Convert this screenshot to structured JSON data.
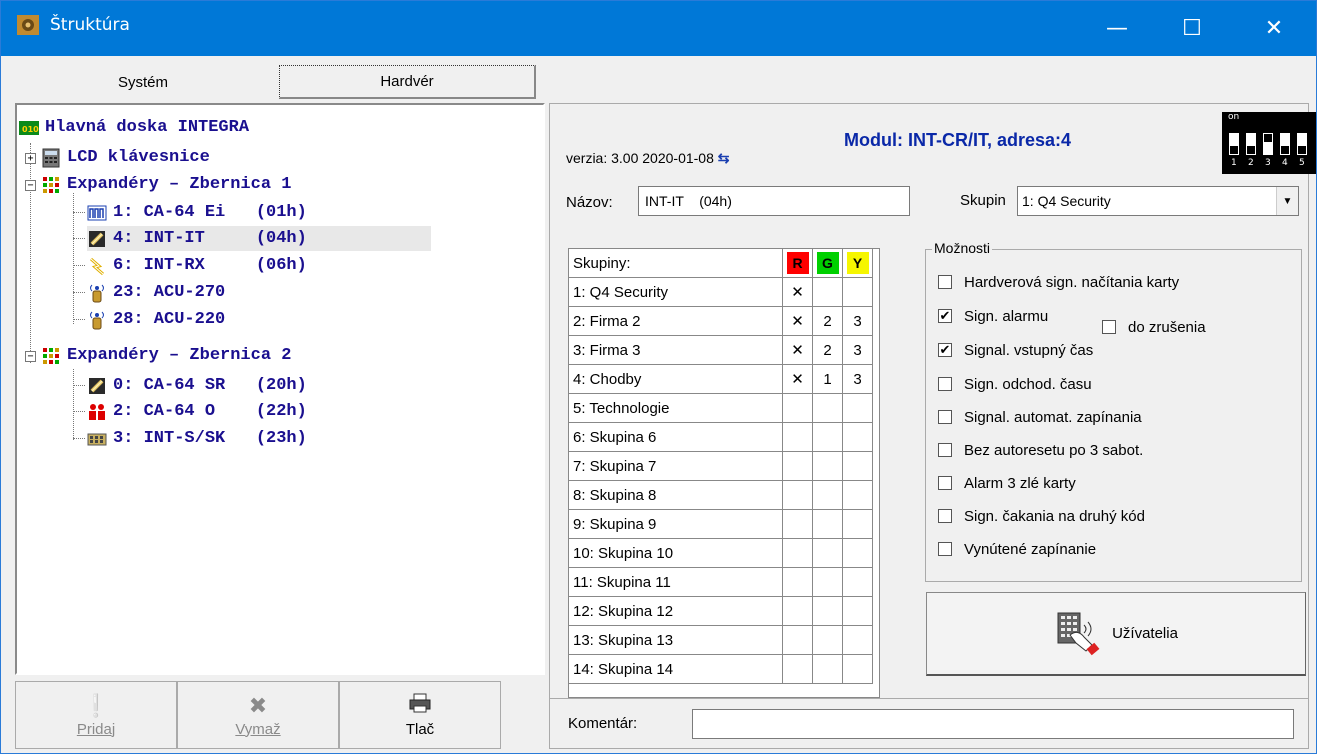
{
  "window": {
    "title": "Štruktúra",
    "controls": {
      "minimize": "—",
      "maximize": "☐",
      "close": "✕"
    }
  },
  "tabs": [
    {
      "label": "Systém",
      "active": false
    },
    {
      "label": "Hardvér",
      "active": true
    }
  ],
  "tree": {
    "root": "Hlavná doska INTEGRA",
    "lcd": "LCD klávesnice",
    "bus1": {
      "label": "Expandéry – Zbernica 1",
      "items": [
        {
          "label": "1: CA-64 Ei   (01h)",
          "icon": "zone-expander-icon"
        },
        {
          "label": "4: INT-IT     (04h)",
          "icon": "proximity-reader-icon",
          "selected": true
        },
        {
          "label": "6: INT-RX     (06h)",
          "icon": "radio-receiver-icon"
        },
        {
          "label": "23: ACU-270",
          "icon": "wireless-controller-icon"
        },
        {
          "label": "28: ACU-220",
          "icon": "wireless-controller-icon"
        }
      ]
    },
    "bus2": {
      "label": "Expandéry – Zbernica 2",
      "items": [
        {
          "label": "0: CA-64 SR   (20h)",
          "icon": "proximity-reader-icon"
        },
        {
          "label": "2: CA-64 O    (22h)",
          "icon": "output-expander-icon"
        },
        {
          "label": "3: INT-S/SK   (23h)",
          "icon": "keypad-icon"
        }
      ]
    }
  },
  "toolbar": {
    "add": {
      "label": "Pridaj",
      "enabled": false
    },
    "delete": {
      "label": "Vymaž",
      "enabled": false
    },
    "print": {
      "label": "Tlač",
      "enabled": true
    }
  },
  "module": {
    "version": "verzia: 3.00 2020-01-08",
    "title": "Modul: INT-CR/IT, adresa:4",
    "dip": {
      "on_label": "on",
      "numbers": [
        "1",
        "2",
        "3",
        "4",
        "5"
      ]
    }
  },
  "name_field": {
    "label": "Názov:",
    "value": "INT-IT    (04h)"
  },
  "group_field": {
    "label": "Skupin",
    "value": "1: Q4 Security"
  },
  "groups_table": {
    "header": "Skupiny:",
    "cols": {
      "r": "R",
      "g": "G",
      "y": "Y"
    },
    "colors": {
      "r": "#ff0000",
      "g": "#00d000",
      "y": "#f6f600"
    },
    "rows": [
      {
        "name": "1: Q4 Security",
        "r": "✕",
        "g": "",
        "y": ""
      },
      {
        "name": "2: Firma 2",
        "r": "✕",
        "g": "2",
        "y": "3"
      },
      {
        "name": "3: Firma 3",
        "r": "✕",
        "g": "2",
        "y": "3"
      },
      {
        "name": "4: Chodby",
        "r": "✕",
        "g": "1",
        "y": "3"
      },
      {
        "name": "5: Technologie",
        "r": "",
        "g": "",
        "y": ""
      },
      {
        "name": "6: Skupina  6",
        "r": "",
        "g": "",
        "y": ""
      },
      {
        "name": "7: Skupina  7",
        "r": "",
        "g": "",
        "y": ""
      },
      {
        "name": "8: Skupina  8",
        "r": "",
        "g": "",
        "y": ""
      },
      {
        "name": "9: Skupina  9",
        "r": "",
        "g": "",
        "y": ""
      },
      {
        "name": "10: Skupina 10",
        "r": "",
        "g": "",
        "y": ""
      },
      {
        "name": "11: Skupina 11",
        "r": "",
        "g": "",
        "y": ""
      },
      {
        "name": "12: Skupina 12",
        "r": "",
        "g": "",
        "y": ""
      },
      {
        "name": "13: Skupina 13",
        "r": "",
        "g": "",
        "y": ""
      },
      {
        "name": "14: Skupina 14",
        "r": "",
        "g": "",
        "y": ""
      }
    ]
  },
  "options": {
    "legend": "Možnosti",
    "items": [
      {
        "label": "Hardverová sign. načítania karty",
        "checked": false
      },
      {
        "label": "Sign. alarmu",
        "checked": true
      },
      {
        "label": "Signal. vstupný čas",
        "checked": true
      },
      {
        "label": "Sign. odchod. času",
        "checked": false
      },
      {
        "label": "Signal. automat. zapínania",
        "checked": false
      },
      {
        "label": "Bez autoresetu po 3 sabot.",
        "checked": false
      },
      {
        "label": "Alarm 3 zlé karty",
        "checked": false
      },
      {
        "label": "Sign. čakania na druhý kód",
        "checked": false
      },
      {
        "label": "Vynútené zapínanie",
        "checked": false
      }
    ],
    "until_cancel": {
      "label": "do zrušenia",
      "checked": false
    }
  },
  "users_button": {
    "label": "Užívatelia"
  },
  "comment": {
    "label": "Komentár:",
    "value": ""
  }
}
